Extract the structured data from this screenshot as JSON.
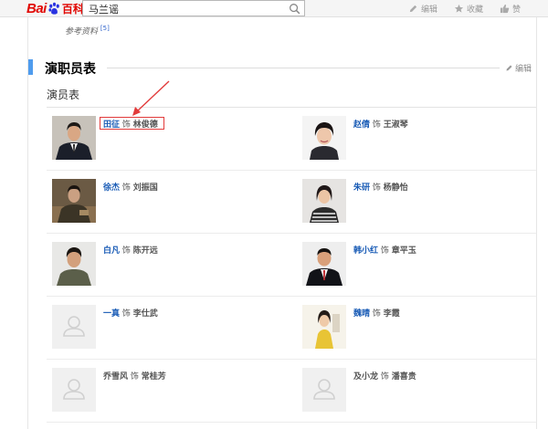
{
  "header": {
    "logo_prefix": "Bai",
    "logo_suffix": "百科",
    "search_value": "马兰谣",
    "tools": [
      {
        "label": "编辑",
        "icon": "pencil-icon"
      },
      {
        "label": "收藏",
        "icon": "star-icon"
      },
      {
        "label": "赞",
        "icon": "thumbs-up-icon"
      }
    ]
  },
  "reference": {
    "label": "参考资料",
    "sup": "[5]"
  },
  "section": {
    "title": "演职员表",
    "edit_label": "编辑",
    "subtitle": "演员表"
  },
  "cast": [
    [
      {
        "actor": "田征",
        "as": "饰",
        "role": "林俊德",
        "link": true,
        "photo": "portrait-man-suit"
      },
      {
        "actor": "赵倩",
        "as": "饰",
        "role": "王淑琴",
        "link": true,
        "photo": "portrait-woman-short-hair"
      }
    ],
    [
      {
        "actor": "徐杰",
        "as": "饰",
        "role": "刘振国",
        "link": true,
        "photo": "portrait-man-seated"
      },
      {
        "actor": "朱研",
        "as": "饰",
        "role": "杨静怡",
        "link": true,
        "photo": "portrait-woman-striped"
      }
    ],
    [
      {
        "actor": "白凡",
        "as": "饰",
        "role": "陈开远",
        "link": true,
        "photo": "portrait-man-green"
      },
      {
        "actor": "韩小红",
        "as": "饰",
        "role": "章平玉",
        "link": true,
        "photo": "portrait-man-tie"
      }
    ],
    [
      {
        "actor": "一真",
        "as": "饰",
        "role": "李仕武",
        "link": true,
        "photo": "placeholder-avatar"
      },
      {
        "actor": "魏晴",
        "as": "饰",
        "role": "李霞",
        "link": true,
        "photo": "portrait-woman-yellow-dress"
      }
    ],
    [
      {
        "actor": "乔雪风",
        "as": "饰",
        "role": "常桂芳",
        "link": false,
        "photo": "placeholder-avatar"
      },
      {
        "actor": "及小龙",
        "as": "饰",
        "role": "潘喜贵",
        "link": false,
        "photo": "placeholder-avatar"
      }
    ]
  ],
  "colors": {
    "brand_red": "#e10601",
    "link_blue": "#1a5cb6",
    "section_accent": "#4f9cee",
    "annotation_red": "#e23b3b"
  }
}
